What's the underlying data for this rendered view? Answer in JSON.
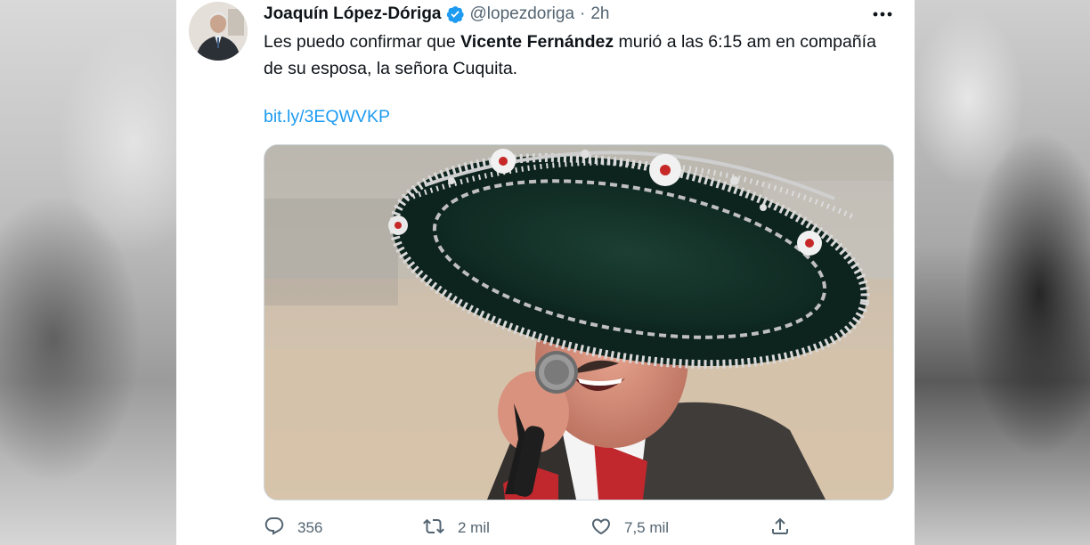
{
  "tweet": {
    "author_name": "Joaquín López-Dóriga",
    "handle": "@lopezdoriga",
    "separator": "·",
    "time": "2h",
    "text_before": "Les puedo confirmar que ",
    "text_bold": "Vicente Fernández",
    "text_after": " murió a las 6:15 am en compañía de su esposa, la señora Cuquita.",
    "link": "bit.ly/3EQWVKP"
  },
  "actions": {
    "replies": "356",
    "retweets": "2 mil",
    "likes": "7,5 mil"
  },
  "icons": {
    "verified": "verified-badge-icon",
    "more": "more-dots-icon",
    "reply": "reply-icon",
    "retweet": "retweet-icon",
    "like": "heart-icon",
    "share": "share-icon"
  },
  "colors": {
    "text": "#0f1419",
    "secondary": "#536471",
    "link": "#1d9bf0",
    "verified": "#1d9bf0"
  }
}
